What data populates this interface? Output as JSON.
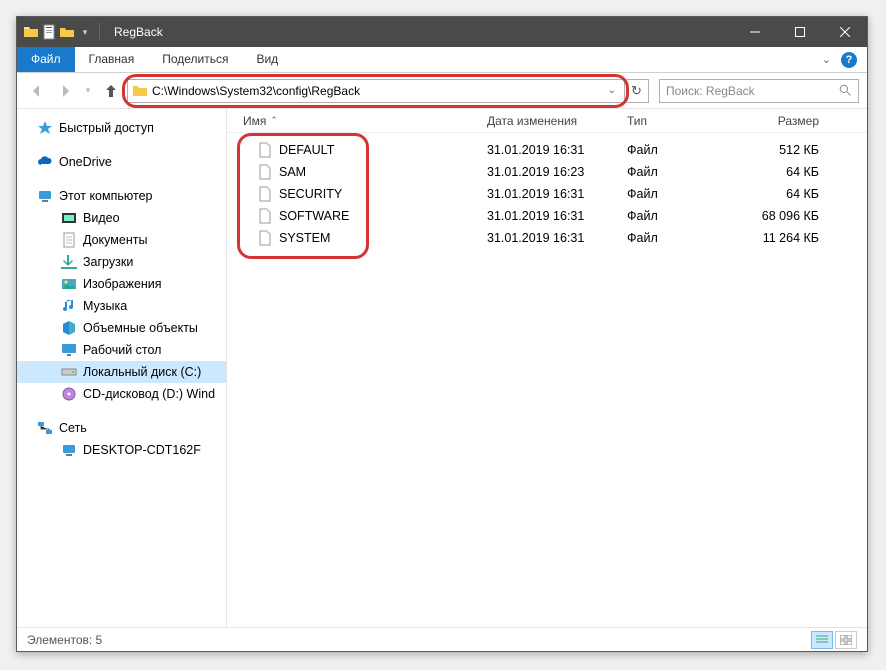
{
  "titlebar": {
    "title": "RegBack"
  },
  "ribbon": {
    "file": "Файл",
    "tabs": [
      "Главная",
      "Поделиться",
      "Вид"
    ]
  },
  "nav": {
    "path": "C:\\Windows\\System32\\config\\RegBack",
    "search_placeholder": "Поиск: RegBack"
  },
  "sidebar": {
    "quick": "Быстрый доступ",
    "onedrive": "OneDrive",
    "thispc": "Этот компьютер",
    "items": [
      "Видео",
      "Документы",
      "Загрузки",
      "Изображения",
      "Музыка",
      "Объемные объекты",
      "Рабочий стол",
      "Локальный диск (C:)",
      "CD-дисковод (D:) Wind"
    ],
    "network": "Сеть",
    "network_items": [
      "DESKTOP-CDT162F"
    ]
  },
  "columns": {
    "name": "Имя",
    "date": "Дата изменения",
    "type": "Тип",
    "size": "Размер"
  },
  "files": [
    {
      "name": "DEFAULT",
      "date": "31.01.2019 16:31",
      "type": "Файл",
      "size": "512 КБ"
    },
    {
      "name": "SAM",
      "date": "31.01.2019 16:23",
      "type": "Файл",
      "size": "64 КБ"
    },
    {
      "name": "SECURITY",
      "date": "31.01.2019 16:31",
      "type": "Файл",
      "size": "64 КБ"
    },
    {
      "name": "SOFTWARE",
      "date": "31.01.2019 16:31",
      "type": "Файл",
      "size": "68 096 КБ"
    },
    {
      "name": "SYSTEM",
      "date": "31.01.2019 16:31",
      "type": "Файл",
      "size": "11 264 КБ"
    }
  ],
  "status": {
    "count_label": "Элементов: 5"
  }
}
